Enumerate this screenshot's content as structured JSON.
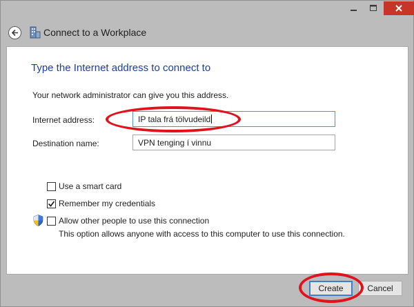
{
  "window": {
    "title": "Connect to a Workplace",
    "controls": {
      "minimize_icon": "minimize-icon",
      "maximize_icon": "maximize-icon",
      "close_icon": "close-icon"
    },
    "close_color": "#c73528"
  },
  "main": {
    "heading": "Type the Internet address to connect to",
    "intro": "Your network administrator can give you this address.",
    "internet_address": {
      "label": "Internet address:",
      "value": "IP tala frá tölvudeild"
    },
    "destination_name": {
      "label": "Destination name:",
      "value": "VPN tenging í vinnu"
    },
    "options": [
      {
        "label": "Use a smart card",
        "checked": false
      },
      {
        "label": "Remember my credentials",
        "checked": true
      },
      {
        "label": "Allow other people to use this connection",
        "checked": false
      }
    ],
    "allow_note": "This option allows anyone with access to this computer to use this connection."
  },
  "buttons": {
    "create": "Create",
    "cancel": "Cancel"
  },
  "colors": {
    "heading": "#1c3f94",
    "annotation": "#e0121c",
    "focus_border": "#4f8fd6"
  }
}
